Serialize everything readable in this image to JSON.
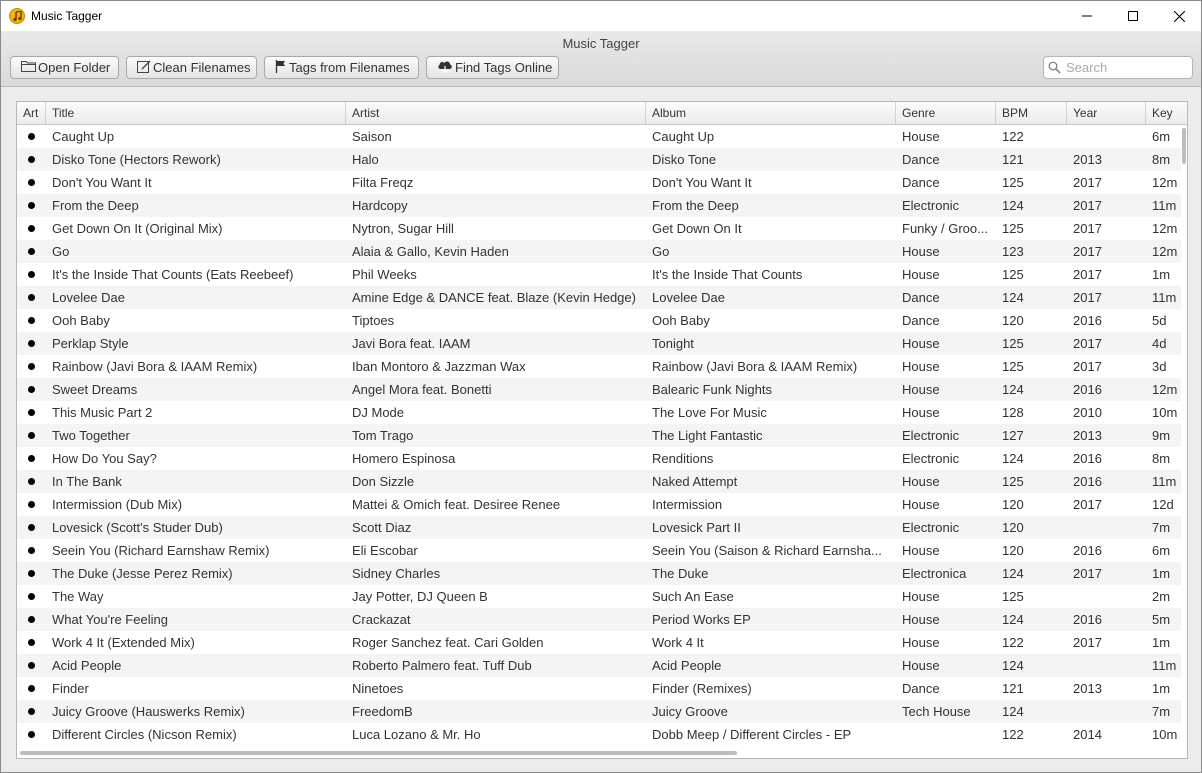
{
  "window": {
    "title": "Music Tagger"
  },
  "toolbar": {
    "title": "Music Tagger",
    "open_folder": "Open Folder",
    "clean_filenames": "Clean Filenames",
    "tags_from_filenames": "Tags from Filenames",
    "find_tags_online": "Find Tags Online",
    "search_placeholder": "Search"
  },
  "table": {
    "columns": [
      "Art",
      "Title",
      "Artist",
      "Album",
      "Genre",
      "BPM",
      "Year",
      "Key"
    ],
    "rows": [
      {
        "title": "Caught Up",
        "artist": "Saison",
        "album": "Caught Up",
        "genre": "House",
        "bpm": "122",
        "year": "",
        "key": "6m"
      },
      {
        "title": "Disko Tone (Hectors Rework)",
        "artist": "Halo",
        "album": "Disko Tone",
        "genre": "Dance",
        "bpm": "121",
        "year": "2013",
        "key": "8m"
      },
      {
        "title": "Don't You Want It",
        "artist": "Filta Freqz",
        "album": "Don't You Want It",
        "genre": "Dance",
        "bpm": "125",
        "year": "2017",
        "key": "12m"
      },
      {
        "title": "From the Deep",
        "artist": "Hardcopy",
        "album": "From the Deep",
        "genre": "Electronic",
        "bpm": "124",
        "year": "2017",
        "key": "11m"
      },
      {
        "title": "Get Down On It (Original Mix)",
        "artist": "Nytron, Sugar Hill",
        "album": "Get Down On It",
        "genre": "Funky / Groo...",
        "bpm": "125",
        "year": "2017",
        "key": "12m"
      },
      {
        "title": "Go",
        "artist": "Alaia & Gallo, Kevin Haden",
        "album": "Go",
        "genre": "House",
        "bpm": "123",
        "year": "2017",
        "key": "12m"
      },
      {
        "title": "It's the Inside That Counts (Eats Reebeef)",
        "artist": "Phil Weeks",
        "album": "It's the Inside That Counts",
        "genre": "House",
        "bpm": "125",
        "year": "2017",
        "key": "1m"
      },
      {
        "title": "Lovelee Dae",
        "artist": "Amine Edge & DANCE feat. Blaze (Kevin Hedge)",
        "album": "Lovelee Dae",
        "genre": "Dance",
        "bpm": "124",
        "year": "2017",
        "key": "11m"
      },
      {
        "title": "Ooh Baby",
        "artist": "Tiptoes",
        "album": "Ooh Baby",
        "genre": "Dance",
        "bpm": "120",
        "year": "2016",
        "key": "5d"
      },
      {
        "title": "Perklap Style",
        "artist": "Javi Bora feat. IAAM",
        "album": "Tonight",
        "genre": "House",
        "bpm": "125",
        "year": "2017",
        "key": "4d"
      },
      {
        "title": "Rainbow (Javi Bora & IAAM Remix)",
        "artist": "Iban Montoro & Jazzman Wax",
        "album": "Rainbow (Javi Bora & IAAM Remix)",
        "genre": "House",
        "bpm": "125",
        "year": "2017",
        "key": "3d"
      },
      {
        "title": "Sweet Dreams",
        "artist": "Angel Mora feat. Bonetti",
        "album": "Balearic Funk Nights",
        "genre": "House",
        "bpm": "124",
        "year": "2016",
        "key": "12m"
      },
      {
        "title": "This Music Part 2",
        "artist": "DJ Mode",
        "album": "The Love For Music",
        "genre": "House",
        "bpm": "128",
        "year": "2010",
        "key": "10m"
      },
      {
        "title": "Two Together",
        "artist": "Tom Trago",
        "album": "The Light Fantastic",
        "genre": "Electronic",
        "bpm": "127",
        "year": "2013",
        "key": "9m"
      },
      {
        "title": "How Do You Say?",
        "artist": "Homero Espinosa",
        "album": "Renditions",
        "genre": "Electronic",
        "bpm": "124",
        "year": "2016",
        "key": "8m"
      },
      {
        "title": "In The Bank",
        "artist": "Don Sizzle",
        "album": "Naked Attempt",
        "genre": "House",
        "bpm": "125",
        "year": "2016",
        "key": "11m"
      },
      {
        "title": "Intermission (Dub Mix)",
        "artist": "Mattei & Omich feat. Desiree Renee",
        "album": "Intermission",
        "genre": "House",
        "bpm": "120",
        "year": "2017",
        "key": "12d"
      },
      {
        "title": "Lovesick (Scott's Studer Dub)",
        "artist": "Scott Diaz",
        "album": "Lovesick Part II",
        "genre": "Electronic",
        "bpm": "120",
        "year": "",
        "key": "7m"
      },
      {
        "title": "Seein You (Richard Earnshaw Remix)",
        "artist": "Eli Escobar",
        "album": "Seein You (Saison & Richard Earnsha...",
        "genre": "House",
        "bpm": "120",
        "year": "2016",
        "key": "6m"
      },
      {
        "title": "The Duke (Jesse Perez Remix)",
        "artist": "Sidney Charles",
        "album": "The Duke",
        "genre": "Electronica",
        "bpm": "124",
        "year": "2017",
        "key": "1m"
      },
      {
        "title": "The Way",
        "artist": "Jay Potter, DJ Queen B",
        "album": "Such An Ease",
        "genre": "House",
        "bpm": "125",
        "year": "",
        "key": "2m"
      },
      {
        "title": "What You're Feeling",
        "artist": "Crackazat",
        "album": "Period Works EP",
        "genre": "House",
        "bpm": "124",
        "year": "2016",
        "key": "5m"
      },
      {
        "title": "Work 4 It (Extended Mix)",
        "artist": "Roger Sanchez feat. Cari Golden",
        "album": "Work 4 It",
        "genre": "House",
        "bpm": "122",
        "year": "2017",
        "key": "1m"
      },
      {
        "title": "Acid People",
        "artist": "Roberto Palmero feat. Tuff Dub",
        "album": "Acid People",
        "genre": "House",
        "bpm": "124",
        "year": "",
        "key": "11m"
      },
      {
        "title": "Finder",
        "artist": "Ninetoes",
        "album": "Finder (Remixes)",
        "genre": "Dance",
        "bpm": "121",
        "year": "2013",
        "key": "1m"
      },
      {
        "title": "Juicy Groove (Hauswerks Remix)",
        "artist": "FreedomB",
        "album": "Juicy Groove",
        "genre": "Tech House",
        "bpm": "124",
        "year": "",
        "key": "7m"
      },
      {
        "title": "Different Circles (Nicson Remix)",
        "artist": "Luca Lozano & Mr. Ho",
        "album": "Dobb Meep / Different Circles - EP",
        "genre": "",
        "bpm": "122",
        "year": "2014",
        "key": "10m"
      }
    ]
  }
}
